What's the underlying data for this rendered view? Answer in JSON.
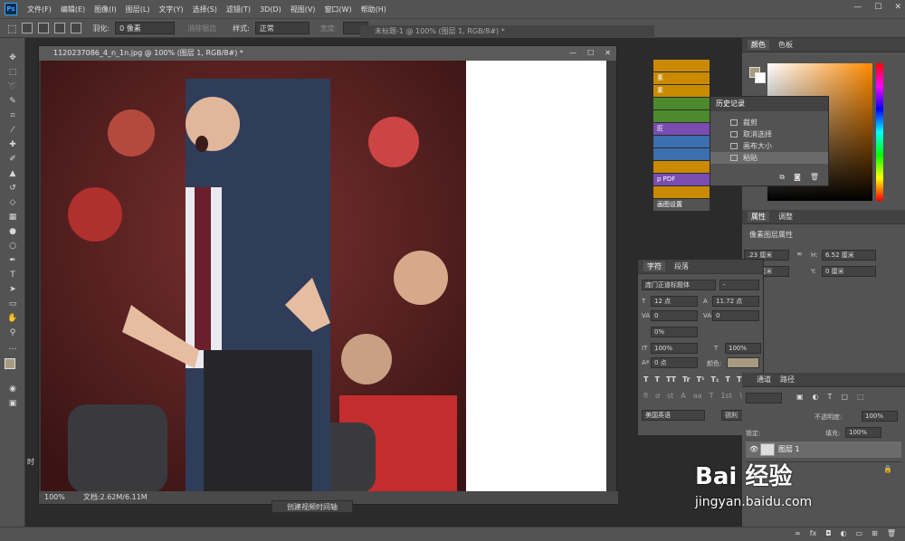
{
  "menubar": {
    "logo": "Ps",
    "items": [
      "文件(F)",
      "编辑(E)",
      "图像(I)",
      "图层(L)",
      "文字(Y)",
      "选择(S)",
      "滤镜(T)",
      "3D(D)",
      "视图(V)",
      "窗口(W)",
      "帮助(H)"
    ],
    "window_controls": [
      "—",
      "☐",
      "✕"
    ]
  },
  "options": {
    "feather_label": "羽化:",
    "feather_value": "0 像素",
    "anti_alias": "消除锯齿",
    "style_label": "样式:",
    "style_value": "正常",
    "width_label": "宽度:"
  },
  "background_doc": {
    "title": "未标题-1 @ 100% (图层 1, RGB/8#) *"
  },
  "document": {
    "title": "1120237086_4_n_1n.jpg @ 100% (图层 1, RGB/8#) *",
    "zoom": "100%",
    "doc_info": "文档:2.62M/6.11M",
    "controls": [
      "—",
      "☐",
      "✕"
    ]
  },
  "timeline_button": "创建视频时间轴",
  "color_panel": {
    "tabs": [
      "颜色",
      "色板"
    ]
  },
  "swatches": {
    "items": [
      {
        "label": "",
        "color": "#c98a00"
      },
      {
        "label": "素",
        "color": "#c98a00"
      },
      {
        "label": "素",
        "color": "#c98a00"
      },
      {
        "label": "",
        "color": "#4d8a2e"
      },
      {
        "label": "",
        "color": "#4d8a2e"
      },
      {
        "label": "匠",
        "color": "#7a4db0"
      },
      {
        "label": "",
        "color": "#3c6fb0"
      },
      {
        "label": "",
        "color": "#3c6fb0"
      },
      {
        "label": "",
        "color": "#c98a00"
      },
      {
        "label": "p PDF",
        "color": "#7a4db0"
      },
      {
        "label": "",
        "color": "#c98a00"
      },
      {
        "label": "画图设置",
        "color": "#535353"
      }
    ]
  },
  "history": {
    "title": "历史记录",
    "items": [
      "裁剪",
      "取消选择",
      "画布大小",
      "粘贴"
    ],
    "selected_index": 3
  },
  "properties": {
    "tabs": [
      "属性",
      "调整"
    ],
    "subtitle": "像素图层属性",
    "w_value": ".23 厘米",
    "h_label": "H:",
    "h_value": "6.52 厘米",
    "x_value": ".15 厘米",
    "y_label": "Y:",
    "y_value": "0 厘米"
  },
  "character": {
    "tabs": [
      "字符",
      "段落"
    ],
    "font_family": "庞门正道标题体",
    "font_style": "-",
    "size": "12 点",
    "leading": "11.72 点",
    "kerning": "0",
    "tracking": "0",
    "scale_pct": "0%",
    "vscale": "100%",
    "hscale": "100%",
    "baseline": "0 点",
    "color_label": "颜色:",
    "language": "美国英语",
    "aa": "锐利",
    "style_buttons": [
      "T",
      "T",
      "TT",
      "Tr",
      "T¹",
      "T₁",
      "T",
      "T"
    ]
  },
  "layers": {
    "tabs": [
      "通道",
      "路径"
    ],
    "opacity_label": "不透明度:",
    "opacity_value": "100%",
    "lock_label": "锁定:",
    "fill_label": "填充:",
    "fill_value": "100%",
    "layer_name": "图层 1"
  },
  "watermark": {
    "text": "Bai 经验",
    "url": "jingyan.baidu.com"
  },
  "side_label": "时"
}
